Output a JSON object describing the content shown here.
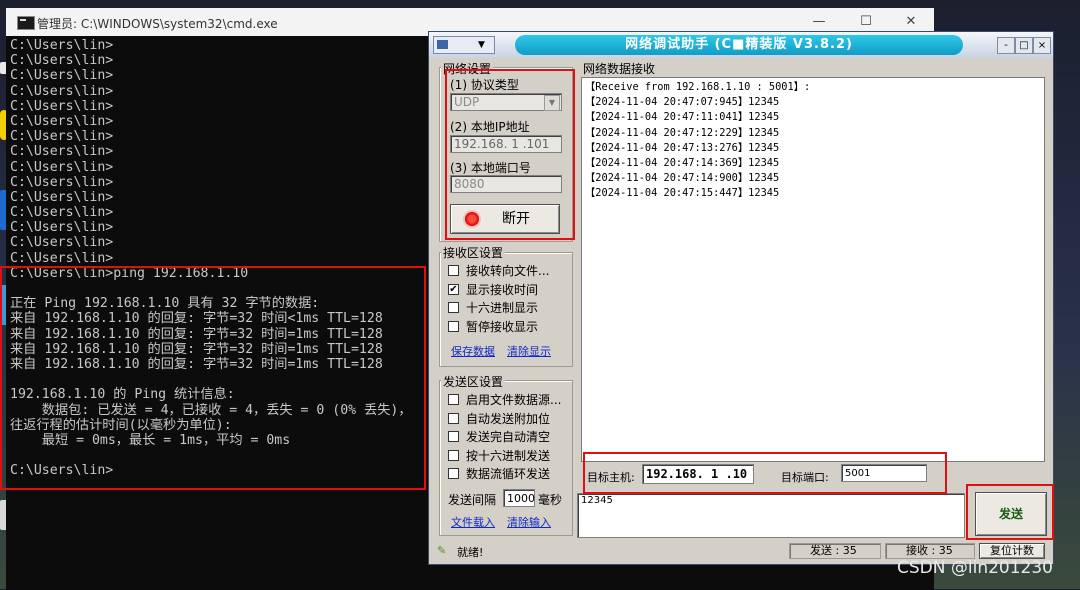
{
  "cmd": {
    "title": "管理员: C:\\WINDOWS\\system32\\cmd.exe",
    "minimize": "—",
    "maximize": "☐",
    "close": "✕",
    "lines": [
      "C:\\Users\\lin>",
      "C:\\Users\\lin>",
      "C:\\Users\\lin>",
      "C:\\Users\\lin>",
      "C:\\Users\\lin>",
      "C:\\Users\\lin>",
      "C:\\Users\\lin>",
      "C:\\Users\\lin>",
      "C:\\Users\\lin>",
      "C:\\Users\\lin>",
      "C:\\Users\\lin>",
      "C:\\Users\\lin>",
      "C:\\Users\\lin>",
      "C:\\Users\\lin>",
      "C:\\Users\\lin>",
      "C:\\Users\\lin>ping 192.168.1.10",
      "",
      "正在 Ping 192.168.1.10 具有 32 字节的数据:",
      "来自 192.168.1.10 的回复: 字节=32 时间<1ms TTL=128",
      "来自 192.168.1.10 的回复: 字节=32 时间=1ms TTL=128",
      "来自 192.168.1.10 的回复: 字节=32 时间=1ms TTL=128",
      "来自 192.168.1.10 的回复: 字节=32 时间=1ms TTL=128",
      "",
      "192.168.1.10 的 Ping 统计信息:",
      "    数据包: 已发送 = 4，已接收 = 4，丢失 = 0 (0% 丢失)，",
      "往返行程的估计时间(以毫秒为单位):",
      "    最短 = 0ms，最长 = 1ms，平均 = 0ms",
      "",
      "C:\\Users\\lin>"
    ]
  },
  "tool": {
    "title": "网络调试助手 (C■精装版 V3.8.2)",
    "minimize": "-",
    "restore": "□",
    "close": "×",
    "net_settings": {
      "group_title": "网络设置",
      "protocol_label": "(1) 协议类型",
      "protocol_value": "UDP",
      "ip_label": "(2) 本地IP地址",
      "ip_value": "192.168. 1 .101",
      "port_label": "(3) 本地端口号",
      "port_value": "8080",
      "disconnect_label": "断开"
    },
    "recv_settings": {
      "group_title": "接收区设置",
      "options": [
        {
          "label": "接收转向文件...",
          "checked": false
        },
        {
          "label": "显示接收时间",
          "checked": true
        },
        {
          "label": "十六进制显示",
          "checked": false
        },
        {
          "label": "暂停接收显示",
          "checked": false
        }
      ],
      "save_link": "保存数据",
      "clear_link": "清除显示"
    },
    "send_settings": {
      "group_title": "发送区设置",
      "options": [
        {
          "label": "启用文件数据源...",
          "checked": false
        },
        {
          "label": "自动发送附加位",
          "checked": false
        },
        {
          "label": "发送完自动清空",
          "checked": false
        },
        {
          "label": "按十六进制发送",
          "checked": false
        },
        {
          "label": "数据流循环发送",
          "checked": false
        }
      ],
      "interval_label": "发送间隔",
      "interval_value": "1000",
      "interval_unit": "毫秒",
      "load_link": "文件载入",
      "clear_link": "清除输入"
    },
    "recv_area": {
      "title": "网络数据接收",
      "lines": [
        "【Receive from 192.168.1.10 : 5001】:",
        "【2024-11-04 20:47:07:945】12345",
        "【2024-11-04 20:47:11:041】12345",
        "【2024-11-04 20:47:12:229】12345",
        "【2024-11-04 20:47:13:276】12345",
        "【2024-11-04 20:47:14:369】12345",
        "【2024-11-04 20:47:14:900】12345",
        "【2024-11-04 20:47:15:447】12345"
      ]
    },
    "target": {
      "host_label": "目标主机:",
      "host_value": "192.168. 1 .10",
      "port_label": "目标端口:",
      "port_value": "5001"
    },
    "send_text": "12345",
    "send_button": "发送",
    "status": {
      "ready": "就绪!",
      "sent_label": "发送 : 35",
      "recv_label": "接收 : 35",
      "reset_label": "复位计数"
    }
  },
  "watermark": "CSDN @lin201230",
  "colors": {
    "accent_red": "#e01010",
    "title_cyan": "#1eb4da",
    "link_blue": "#1028c8"
  }
}
